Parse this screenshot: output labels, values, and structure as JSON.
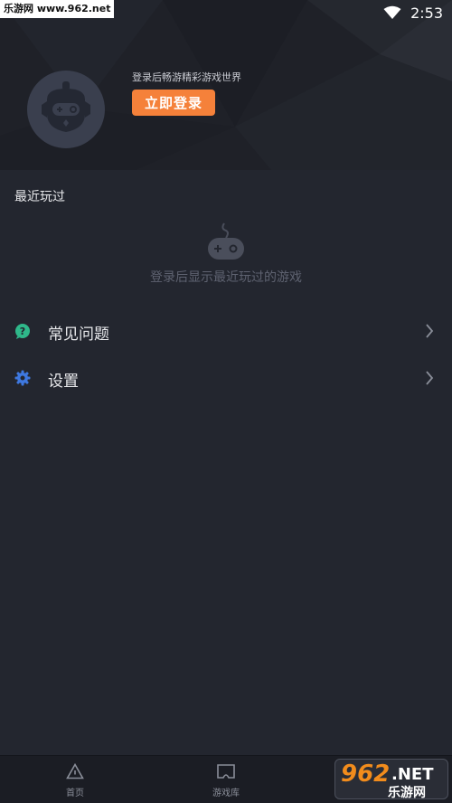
{
  "watermark_top": "乐游网 www.962.net",
  "status_bar": {
    "time": "2:53",
    "wifi_icon": "wifi-icon"
  },
  "profile": {
    "avatar_icon": "gamepad-mascot-icon",
    "tagline": "登录后畅游精彩游戏世界",
    "login_button": "立即登录"
  },
  "recent": {
    "title": "最近玩过",
    "empty_icon": "gamepad-icon",
    "empty_text": "登录后显示最近玩过的游戏"
  },
  "menu": [
    {
      "label": "常见问题",
      "icon": "help-icon",
      "icon_color": "#2fb88a"
    },
    {
      "label": "设置",
      "icon": "gear-icon",
      "icon_color": "#3e78e0"
    }
  ],
  "bottom_nav": [
    {
      "label": "首页",
      "icon": "home-triangle-icon"
    },
    {
      "label": "游戏库",
      "icon": "game-library-icon"
    }
  ],
  "watermark_logo": {
    "number": "962",
    "suffix": ".NET",
    "name": "乐游网"
  },
  "colors": {
    "accent": "#f5813a",
    "background": "#23262f",
    "header": "#1f2128"
  }
}
